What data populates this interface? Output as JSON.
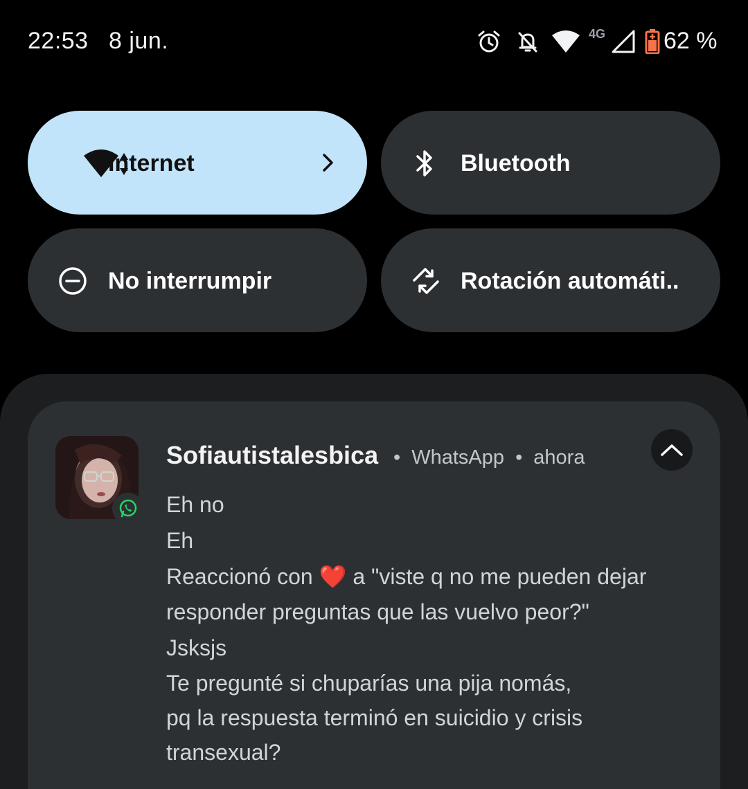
{
  "status_bar": {
    "time": "22:53",
    "date": "8 jun.",
    "network_type": "4G",
    "battery": "62 %",
    "icons": [
      "alarm-icon",
      "notifications-off-icon",
      "wifi-icon",
      "cellular-signal-icon",
      "battery-saver-icon"
    ],
    "battery_color": "#f4744a"
  },
  "quick_settings": {
    "internet": {
      "label": "Internet",
      "active": true
    },
    "bluetooth": {
      "label": "Bluetooth",
      "active": false
    },
    "dnd": {
      "label": "No interrumpir",
      "active": false
    },
    "rotation": {
      "label": "Rotación automáti..",
      "active": false
    },
    "active_color": "#c2e4fa",
    "inactive_color": "#2d3033"
  },
  "notification": {
    "sender": "Sofiautistalesbica",
    "app": "WhatsApp",
    "time": "ahora",
    "separator": "•",
    "app_badge_color": "#25d366",
    "messages": {
      "m1": "Eh no",
      "m2": "Eh",
      "m3_prefix": "Reaccionó con ",
      "m3_emoji": "❤️",
      "m3_suffix": " a \"viste q no me pueden dejar",
      "m3_line2": "responder preguntas que las vuelvo peor?\"",
      "m4": "Jsksjs",
      "m5_line1": "Te pregunté si chuparías una pija nomás,",
      "m5_line2": "pq la respuesta terminó en suicidio y crisis",
      "m5_line3": "transexual?"
    }
  }
}
